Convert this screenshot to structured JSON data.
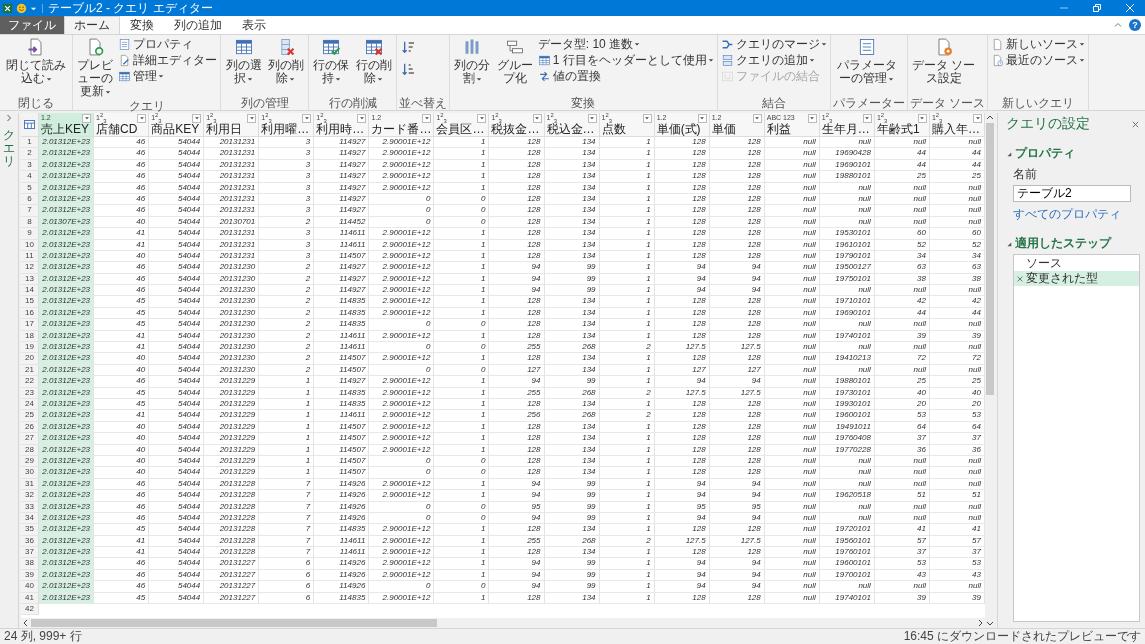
{
  "window": {
    "title": "テーブル2 - クエリ エディター"
  },
  "ribbon": {
    "file_tab": "ファイル",
    "help": "?",
    "tabs": [
      {
        "label": "ホーム",
        "selected": true
      },
      {
        "label": "変換",
        "selected": false
      },
      {
        "label": "列の追加",
        "selected": false
      },
      {
        "label": "表示",
        "selected": false
      }
    ],
    "groups": [
      {
        "label": "閉じる",
        "items": [
          {
            "label": "閉じて読み込む",
            "kind": "large",
            "dropdown": true
          }
        ]
      },
      {
        "label": "クエリ",
        "items": [
          {
            "label": "プレビューの更新",
            "kind": "large",
            "dropdown": true
          },
          {
            "label": "プロパティ",
            "kind": "small",
            "dropdown": false
          },
          {
            "label": "詳細エディター",
            "kind": "small",
            "dropdown": false
          },
          {
            "label": "管理",
            "kind": "small",
            "dropdown": true
          }
        ]
      },
      {
        "label": "列の管理",
        "items": [
          {
            "label": "列の選択",
            "kind": "large",
            "dropdown": true
          },
          {
            "label": "列の削除",
            "kind": "large",
            "dropdown": true
          }
        ]
      },
      {
        "label": "行の削減",
        "items": [
          {
            "label": "行の保持",
            "kind": "large",
            "dropdown": true
          },
          {
            "label": "行の削除",
            "kind": "large",
            "dropdown": true
          }
        ]
      },
      {
        "label": "並べ替え",
        "items": [
          {
            "kind": "icon",
            "dropdown": false
          },
          {
            "kind": "icon",
            "dropdown": false
          }
        ]
      },
      {
        "label": "変換",
        "items": [
          {
            "label": "列の分割",
            "kind": "large",
            "dropdown": true
          },
          {
            "label": "グループ化",
            "kind": "large",
            "dropdown": false
          },
          {
            "label": "データ型: 10 進数",
            "kind": "small",
            "dropdown": true
          },
          {
            "label": "1 行目をヘッダーとして使用",
            "kind": "small",
            "dropdown": true
          },
          {
            "label": "値の置換",
            "kind": "small",
            "dropdown": false
          }
        ]
      },
      {
        "label": "結合",
        "items": [
          {
            "label": "クエリのマージ",
            "kind": "small",
            "dropdown": true,
            "disabled": false
          },
          {
            "label": "クエリの追加",
            "kind": "small",
            "dropdown": true,
            "disabled": false
          },
          {
            "label": "ファイルの結合",
            "kind": "small",
            "dropdown": false,
            "disabled": true
          }
        ]
      },
      {
        "label": "パラメーター",
        "items": [
          {
            "label": "パラメーターの管理",
            "kind": "large",
            "dropdown": true
          }
        ]
      },
      {
        "label": "データ ソース",
        "items": [
          {
            "label": "データ ソース設定",
            "kind": "large",
            "dropdown": false
          }
        ]
      },
      {
        "label": "新しいクエリ",
        "items": [
          {
            "label": "新しいソース",
            "kind": "small",
            "dropdown": true
          },
          {
            "label": "最近のソース",
            "kind": "small",
            "dropdown": true
          }
        ]
      }
    ]
  },
  "queries_pane": {
    "label": "クエリ"
  },
  "table": {
    "columns": [
      {
        "type": "1.2",
        "name": "売上KEY",
        "selected": true
      },
      {
        "type": "1$^{2}$$_{3}$",
        "name": "店舗CD",
        "selected": false
      },
      {
        "type": "1$^{2}$$_{3}$",
        "name": "商品KEY",
        "selected": false
      },
      {
        "type": "1$^{2}$$_{3}$",
        "name": "利用日",
        "selected": false
      },
      {
        "type": "1$^{2}$$_{3}$",
        "name": "利用曜…",
        "selected": false
      },
      {
        "type": "1$^{2}$$_{3}$",
        "name": "利用時…",
        "selected": false
      },
      {
        "type": "1.2",
        "name": "カード番…",
        "selected": false
      },
      {
        "type": "1$^{2}$$_{3}$",
        "name": "会員区…",
        "selected": false
      },
      {
        "type": "1$^{2}$$_{3}$",
        "name": "税抜金…",
        "selected": false
      },
      {
        "type": "1$^{2}$$_{3}$",
        "name": "税込金…",
        "selected": false
      },
      {
        "type": "1$^{2}$$_{3}$",
        "name": "点数",
        "selected": false
      },
      {
        "type": "1.2",
        "name": "単価(式)",
        "selected": false
      },
      {
        "type": "1.2",
        "name": "単価",
        "selected": false
      },
      {
        "type": "ABC 123",
        "name": "利益",
        "selected": false
      },
      {
        "type": "1$^{2}$$_{3}$",
        "name": "生年月…",
        "selected": false
      },
      {
        "type": "1$^{2}$$_{3}$",
        "name": "年齢式1",
        "selected": false
      },
      {
        "type": "1$^{2}$$_{3}$",
        "name": "購入年…",
        "selected": false
      }
    ],
    "rows": [
      {
        "number": "1",
        "cells": [
          "2.01312E+23",
          "46",
          "54044",
          "20131231",
          "3",
          "114927",
          "2.90001E+12",
          "1",
          "128",
          "134",
          "1",
          "128",
          "128",
          "null",
          "null",
          "null",
          "null"
        ]
      },
      {
        "number": "2",
        "cells": [
          "2.01312E+23",
          "46",
          "54044",
          "20131231",
          "3",
          "114927",
          "2.90001E+12",
          "1",
          "128",
          "134",
          "1",
          "128",
          "128",
          "null",
          "19690428",
          "44",
          "44"
        ]
      },
      {
        "number": "3",
        "cells": [
          "2.01312E+23",
          "46",
          "54044",
          "20131231",
          "3",
          "114927",
          "2.90001E+12",
          "1",
          "128",
          "134",
          "1",
          "128",
          "128",
          "null",
          "19690101",
          "44",
          "44"
        ]
      },
      {
        "number": "4",
        "cells": [
          "2.01312E+23",
          "46",
          "54044",
          "20131231",
          "3",
          "114927",
          "2.90001E+12",
          "1",
          "128",
          "134",
          "1",
          "128",
          "128",
          "null",
          "19880101",
          "25",
          "25"
        ]
      },
      {
        "number": "5",
        "cells": [
          "2.01312E+23",
          "46",
          "54044",
          "20131231",
          "3",
          "114927",
          "2.90001E+12",
          "1",
          "128",
          "134",
          "1",
          "128",
          "128",
          "null",
          "null",
          "null",
          "null"
        ]
      },
      {
        "number": "6",
        "cells": [
          "2.01312E+23",
          "46",
          "54044",
          "20131231",
          "3",
          "114927",
          "0",
          "0",
          "128",
          "134",
          "1",
          "128",
          "128",
          "null",
          "null",
          "null",
          "null"
        ]
      },
      {
        "number": "7",
        "cells": [
          "2.01312E+23",
          "46",
          "54044",
          "20131231",
          "3",
          "114927",
          "0",
          "0",
          "128",
          "134",
          "1",
          "128",
          "128",
          "null",
          "null",
          "null",
          "null"
        ]
      },
      {
        "number": "8",
        "cells": [
          "2.01307E+23",
          "40",
          "54044",
          "20130701",
          "2",
          "114452",
          "0",
          "0",
          "128",
          "134",
          "1",
          "128",
          "128",
          "null",
          "null",
          "null",
          "null"
        ]
      },
      {
        "number": "9",
        "cells": [
          "2.01312E+23",
          "41",
          "54044",
          "20131231",
          "3",
          "114611",
          "2.90001E+12",
          "1",
          "128",
          "134",
          "1",
          "128",
          "128",
          "null",
          "19530101",
          "60",
          "60"
        ]
      },
      {
        "number": "10",
        "cells": [
          "2.01312E+23",
          "41",
          "54044",
          "20131231",
          "3",
          "114611",
          "2.90001E+12",
          "1",
          "128",
          "134",
          "1",
          "128",
          "128",
          "null",
          "19610101",
          "52",
          "52"
        ]
      },
      {
        "number": "11",
        "cells": [
          "2.01312E+23",
          "40",
          "54044",
          "20131231",
          "3",
          "114507",
          "2.90001E+12",
          "1",
          "128",
          "134",
          "1",
          "128",
          "128",
          "null",
          "19790101",
          "34",
          "34"
        ]
      },
      {
        "number": "12",
        "cells": [
          "2.01312E+23",
          "46",
          "54044",
          "20131230",
          "2",
          "114927",
          "2.90001E+12",
          "1",
          "94",
          "99",
          "1",
          "94",
          "94",
          "null",
          "19500127",
          "63",
          "63"
        ]
      },
      {
        "number": "13",
        "cells": [
          "2.01312E+23",
          "46",
          "54044",
          "20131230",
          "2",
          "114927",
          "2.90001E+12",
          "1",
          "94",
          "99",
          "1",
          "94",
          "94",
          "null",
          "19750101",
          "38",
          "38"
        ]
      },
      {
        "number": "14",
        "cells": [
          "2.01312E+23",
          "46",
          "54044",
          "20131230",
          "2",
          "114927",
          "2.90001E+12",
          "1",
          "94",
          "99",
          "1",
          "94",
          "94",
          "null",
          "null",
          "null",
          "null"
        ]
      },
      {
        "number": "15",
        "cells": [
          "2.01312E+23",
          "45",
          "54044",
          "20131230",
          "2",
          "114835",
          "2.90001E+12",
          "1",
          "128",
          "134",
          "1",
          "128",
          "128",
          "null",
          "19710101",
          "42",
          "42"
        ]
      },
      {
        "number": "16",
        "cells": [
          "2.01312E+23",
          "45",
          "54044",
          "20131230",
          "2",
          "114835",
          "2.90001E+12",
          "1",
          "128",
          "134",
          "1",
          "128",
          "128",
          "null",
          "19690101",
          "44",
          "44"
        ]
      },
      {
        "number": "17",
        "cells": [
          "2.01312E+23",
          "45",
          "54044",
          "20131230",
          "2",
          "114835",
          "0",
          "0",
          "128",
          "134",
          "1",
          "128",
          "128",
          "null",
          "null",
          "null",
          "null"
        ]
      },
      {
        "number": "18",
        "cells": [
          "2.01312E+23",
          "41",
          "54044",
          "20131230",
          "2",
          "114611",
          "2.90001E+12",
          "1",
          "128",
          "134",
          "1",
          "128",
          "128",
          "null",
          "19740101",
          "39",
          "39"
        ]
      },
      {
        "number": "19",
        "cells": [
          "2.01312E+23",
          "41",
          "54044",
          "20131230",
          "2",
          "114611",
          "0",
          "0",
          "255",
          "268",
          "2",
          "127.5",
          "127.5",
          "null",
          "null",
          "null",
          "null"
        ]
      },
      {
        "number": "20",
        "cells": [
          "2.01312E+23",
          "40",
          "54044",
          "20131230",
          "2",
          "114507",
          "2.90001E+12",
          "1",
          "128",
          "134",
          "1",
          "128",
          "128",
          "null",
          "19410213",
          "72",
          "72"
        ]
      },
      {
        "number": "21",
        "cells": [
          "2.01312E+23",
          "40",
          "54044",
          "20131230",
          "2",
          "114507",
          "0",
          "0",
          "127",
          "134",
          "1",
          "127",
          "127",
          "null",
          "null",
          "null",
          "null"
        ]
      },
      {
        "number": "22",
        "cells": [
          "2.01312E+23",
          "46",
          "54044",
          "20131229",
          "1",
          "114927",
          "2.90001E+12",
          "1",
          "94",
          "99",
          "1",
          "94",
          "94",
          "null",
          "19880101",
          "25",
          "25"
        ]
      },
      {
        "number": "23",
        "cells": [
          "2.01312E+23",
          "45",
          "54044",
          "20131229",
          "1",
          "114835",
          "2.90001E+12",
          "1",
          "255",
          "268",
          "2",
          "127.5",
          "127.5",
          "null",
          "19730101",
          "40",
          "40"
        ]
      },
      {
        "number": "24",
        "cells": [
          "2.01312E+23",
          "45",
          "54044",
          "20131229",
          "1",
          "114835",
          "2.90001E+12",
          "1",
          "128",
          "134",
          "1",
          "128",
          "128",
          "null",
          "19930101",
          "20",
          "20"
        ]
      },
      {
        "number": "25",
        "cells": [
          "2.01312E+23",
          "41",
          "54044",
          "20131229",
          "1",
          "114611",
          "2.90001E+12",
          "1",
          "256",
          "268",
          "2",
          "128",
          "128",
          "null",
          "19600101",
          "53",
          "53"
        ]
      },
      {
        "number": "26",
        "cells": [
          "2.01312E+23",
          "40",
          "54044",
          "20131229",
          "1",
          "114507",
          "2.90001E+12",
          "1",
          "128",
          "134",
          "1",
          "128",
          "128",
          "null",
          "19491011",
          "64",
          "64"
        ]
      },
      {
        "number": "27",
        "cells": [
          "2.01312E+23",
          "40",
          "54044",
          "20131229",
          "1",
          "114507",
          "2.90001E+12",
          "1",
          "128",
          "134",
          "1",
          "128",
          "128",
          "null",
          "19760408",
          "37",
          "37"
        ]
      },
      {
        "number": "28",
        "cells": [
          "2.01312E+23",
          "40",
          "54044",
          "20131229",
          "1",
          "114507",
          "2.90001E+12",
          "1",
          "128",
          "134",
          "1",
          "128",
          "128",
          "null",
          "19770228",
          "36",
          "36"
        ]
      },
      {
        "number": "29",
        "cells": [
          "2.01312E+23",
          "40",
          "54044",
          "20131229",
          "1",
          "114507",
          "0",
          "0",
          "128",
          "134",
          "1",
          "128",
          "128",
          "null",
          "null",
          "null",
          "null"
        ]
      },
      {
        "number": "30",
        "cells": [
          "2.01312E+23",
          "40",
          "54044",
          "20131229",
          "1",
          "114507",
          "0",
          "0",
          "128",
          "134",
          "1",
          "128",
          "128",
          "null",
          "null",
          "null",
          "null"
        ]
      },
      {
        "number": "31",
        "cells": [
          "2.01312E+23",
          "46",
          "54044",
          "20131228",
          "7",
          "114926",
          "2.90001E+12",
          "1",
          "94",
          "99",
          "1",
          "94",
          "94",
          "null",
          "null",
          "null",
          "null"
        ]
      },
      {
        "number": "32",
        "cells": [
          "2.01312E+23",
          "46",
          "54044",
          "20131228",
          "7",
          "114926",
          "2.90001E+12",
          "1",
          "94",
          "99",
          "1",
          "94",
          "94",
          "null",
          "19620518",
          "51",
          "51"
        ]
      },
      {
        "number": "33",
        "cells": [
          "2.01312E+23",
          "46",
          "54044",
          "20131228",
          "7",
          "114926",
          "0",
          "0",
          "95",
          "99",
          "1",
          "95",
          "95",
          "null",
          "null",
          "null",
          "null"
        ]
      },
      {
        "number": "34",
        "cells": [
          "2.01312E+23",
          "46",
          "54044",
          "20131228",
          "7",
          "114926",
          "0",
          "0",
          "94",
          "99",
          "1",
          "94",
          "94",
          "null",
          "null",
          "null",
          "null"
        ]
      },
      {
        "number": "35",
        "cells": [
          "2.01312E+23",
          "45",
          "54044",
          "20131228",
          "7",
          "114835",
          "2.90001E+12",
          "1",
          "128",
          "134",
          "1",
          "128",
          "128",
          "null",
          "19720101",
          "41",
          "41"
        ]
      },
      {
        "number": "36",
        "cells": [
          "2.01312E+23",
          "41",
          "54044",
          "20131228",
          "7",
          "114611",
          "2.90001E+12",
          "1",
          "255",
          "268",
          "2",
          "127.5",
          "127.5",
          "null",
          "19560101",
          "57",
          "57"
        ]
      },
      {
        "number": "37",
        "cells": [
          "2.01312E+23",
          "41",
          "54044",
          "20131228",
          "7",
          "114611",
          "2.90001E+12",
          "1",
          "128",
          "134",
          "1",
          "128",
          "128",
          "null",
          "19760101",
          "37",
          "37"
        ]
      },
      {
        "number": "38",
        "cells": [
          "2.01312E+23",
          "46",
          "54044",
          "20131227",
          "6",
          "114926",
          "2.90001E+12",
          "1",
          "94",
          "99",
          "1",
          "94",
          "94",
          "null",
          "19600101",
          "53",
          "53"
        ]
      },
      {
        "number": "39",
        "cells": [
          "2.01312E+23",
          "46",
          "54044",
          "20131227",
          "6",
          "114926",
          "2.90001E+12",
          "1",
          "94",
          "99",
          "1",
          "94",
          "94",
          "null",
          "19700101",
          "43",
          "43"
        ]
      },
      {
        "number": "40",
        "cells": [
          "2.01312E+23",
          "46",
          "54044",
          "20131227",
          "6",
          "114926",
          "0",
          "0",
          "94",
          "99",
          "1",
          "94",
          "94",
          "null",
          "null",
          "null",
          "null"
        ]
      },
      {
        "number": "41",
        "cells": [
          "2.01312E+23",
          "45",
          "54044",
          "20131227",
          "6",
          "114835",
          "2.90001E+12",
          "1",
          "128",
          "134",
          "1",
          "128",
          "128",
          "null",
          "19740101",
          "39",
          "39"
        ]
      },
      {
        "number": "42"
      }
    ]
  },
  "query_settings": {
    "title": "クエリの設定",
    "properties": {
      "heading": "プロパティ",
      "name_label": "名前",
      "name_value": "テーブル2",
      "all_properties_link": "すべてのプロパティ"
    },
    "applied_steps": {
      "heading": "適用したステップ",
      "steps": [
        {
          "label": "ソース",
          "selected": false
        },
        {
          "label": "変更された型",
          "selected": true
        }
      ]
    }
  },
  "status_bar": {
    "left": "24 列, 999+ 行",
    "right": "16:45 にダウンロードされたプレビューです"
  }
}
